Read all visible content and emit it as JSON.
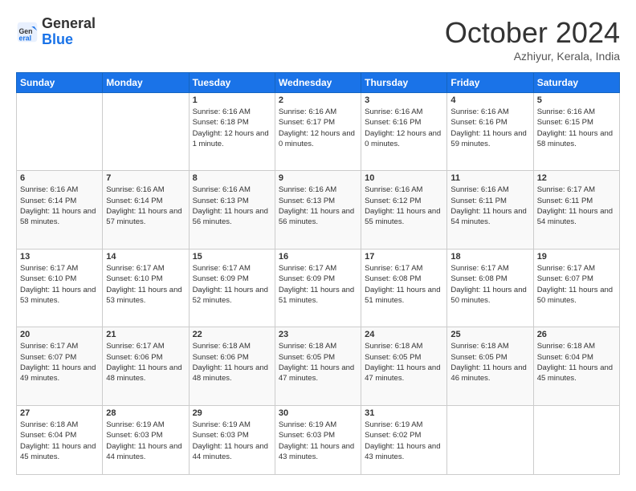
{
  "logo": {
    "line1": "General",
    "line2": "Blue"
  },
  "header": {
    "month": "October 2024",
    "location": "Azhiyur, Kerala, India"
  },
  "weekdays": [
    "Sunday",
    "Monday",
    "Tuesday",
    "Wednesday",
    "Thursday",
    "Friday",
    "Saturday"
  ],
  "weeks": [
    [
      {
        "day": "",
        "sunrise": "",
        "sunset": "",
        "daylight": ""
      },
      {
        "day": "",
        "sunrise": "",
        "sunset": "",
        "daylight": ""
      },
      {
        "day": "1",
        "sunrise": "Sunrise: 6:16 AM",
        "sunset": "Sunset: 6:18 PM",
        "daylight": "Daylight: 12 hours and 1 minute."
      },
      {
        "day": "2",
        "sunrise": "Sunrise: 6:16 AM",
        "sunset": "Sunset: 6:17 PM",
        "daylight": "Daylight: 12 hours and 0 minutes."
      },
      {
        "day": "3",
        "sunrise": "Sunrise: 6:16 AM",
        "sunset": "Sunset: 6:16 PM",
        "daylight": "Daylight: 12 hours and 0 minutes."
      },
      {
        "day": "4",
        "sunrise": "Sunrise: 6:16 AM",
        "sunset": "Sunset: 6:16 PM",
        "daylight": "Daylight: 11 hours and 59 minutes."
      },
      {
        "day": "5",
        "sunrise": "Sunrise: 6:16 AM",
        "sunset": "Sunset: 6:15 PM",
        "daylight": "Daylight: 11 hours and 58 minutes."
      }
    ],
    [
      {
        "day": "6",
        "sunrise": "Sunrise: 6:16 AM",
        "sunset": "Sunset: 6:14 PM",
        "daylight": "Daylight: 11 hours and 58 minutes."
      },
      {
        "day": "7",
        "sunrise": "Sunrise: 6:16 AM",
        "sunset": "Sunset: 6:14 PM",
        "daylight": "Daylight: 11 hours and 57 minutes."
      },
      {
        "day": "8",
        "sunrise": "Sunrise: 6:16 AM",
        "sunset": "Sunset: 6:13 PM",
        "daylight": "Daylight: 11 hours and 56 minutes."
      },
      {
        "day": "9",
        "sunrise": "Sunrise: 6:16 AM",
        "sunset": "Sunset: 6:13 PM",
        "daylight": "Daylight: 11 hours and 56 minutes."
      },
      {
        "day": "10",
        "sunrise": "Sunrise: 6:16 AM",
        "sunset": "Sunset: 6:12 PM",
        "daylight": "Daylight: 11 hours and 55 minutes."
      },
      {
        "day": "11",
        "sunrise": "Sunrise: 6:16 AM",
        "sunset": "Sunset: 6:11 PM",
        "daylight": "Daylight: 11 hours and 54 minutes."
      },
      {
        "day": "12",
        "sunrise": "Sunrise: 6:17 AM",
        "sunset": "Sunset: 6:11 PM",
        "daylight": "Daylight: 11 hours and 54 minutes."
      }
    ],
    [
      {
        "day": "13",
        "sunrise": "Sunrise: 6:17 AM",
        "sunset": "Sunset: 6:10 PM",
        "daylight": "Daylight: 11 hours and 53 minutes."
      },
      {
        "day": "14",
        "sunrise": "Sunrise: 6:17 AM",
        "sunset": "Sunset: 6:10 PM",
        "daylight": "Daylight: 11 hours and 53 minutes."
      },
      {
        "day": "15",
        "sunrise": "Sunrise: 6:17 AM",
        "sunset": "Sunset: 6:09 PM",
        "daylight": "Daylight: 11 hours and 52 minutes."
      },
      {
        "day": "16",
        "sunrise": "Sunrise: 6:17 AM",
        "sunset": "Sunset: 6:09 PM",
        "daylight": "Daylight: 11 hours and 51 minutes."
      },
      {
        "day": "17",
        "sunrise": "Sunrise: 6:17 AM",
        "sunset": "Sunset: 6:08 PM",
        "daylight": "Daylight: 11 hours and 51 minutes."
      },
      {
        "day": "18",
        "sunrise": "Sunrise: 6:17 AM",
        "sunset": "Sunset: 6:08 PM",
        "daylight": "Daylight: 11 hours and 50 minutes."
      },
      {
        "day": "19",
        "sunrise": "Sunrise: 6:17 AM",
        "sunset": "Sunset: 6:07 PM",
        "daylight": "Daylight: 11 hours and 50 minutes."
      }
    ],
    [
      {
        "day": "20",
        "sunrise": "Sunrise: 6:17 AM",
        "sunset": "Sunset: 6:07 PM",
        "daylight": "Daylight: 11 hours and 49 minutes."
      },
      {
        "day": "21",
        "sunrise": "Sunrise: 6:17 AM",
        "sunset": "Sunset: 6:06 PM",
        "daylight": "Daylight: 11 hours and 48 minutes."
      },
      {
        "day": "22",
        "sunrise": "Sunrise: 6:18 AM",
        "sunset": "Sunset: 6:06 PM",
        "daylight": "Daylight: 11 hours and 48 minutes."
      },
      {
        "day": "23",
        "sunrise": "Sunrise: 6:18 AM",
        "sunset": "Sunset: 6:05 PM",
        "daylight": "Daylight: 11 hours and 47 minutes."
      },
      {
        "day": "24",
        "sunrise": "Sunrise: 6:18 AM",
        "sunset": "Sunset: 6:05 PM",
        "daylight": "Daylight: 11 hours and 47 minutes."
      },
      {
        "day": "25",
        "sunrise": "Sunrise: 6:18 AM",
        "sunset": "Sunset: 6:05 PM",
        "daylight": "Daylight: 11 hours and 46 minutes."
      },
      {
        "day": "26",
        "sunrise": "Sunrise: 6:18 AM",
        "sunset": "Sunset: 6:04 PM",
        "daylight": "Daylight: 11 hours and 45 minutes."
      }
    ],
    [
      {
        "day": "27",
        "sunrise": "Sunrise: 6:18 AM",
        "sunset": "Sunset: 6:04 PM",
        "daylight": "Daylight: 11 hours and 45 minutes."
      },
      {
        "day": "28",
        "sunrise": "Sunrise: 6:19 AM",
        "sunset": "Sunset: 6:03 PM",
        "daylight": "Daylight: 11 hours and 44 minutes."
      },
      {
        "day": "29",
        "sunrise": "Sunrise: 6:19 AM",
        "sunset": "Sunset: 6:03 PM",
        "daylight": "Daylight: 11 hours and 44 minutes."
      },
      {
        "day": "30",
        "sunrise": "Sunrise: 6:19 AM",
        "sunset": "Sunset: 6:03 PM",
        "daylight": "Daylight: 11 hours and 43 minutes."
      },
      {
        "day": "31",
        "sunrise": "Sunrise: 6:19 AM",
        "sunset": "Sunset: 6:02 PM",
        "daylight": "Daylight: 11 hours and 43 minutes."
      },
      {
        "day": "",
        "sunrise": "",
        "sunset": "",
        "daylight": ""
      },
      {
        "day": "",
        "sunrise": "",
        "sunset": "",
        "daylight": ""
      }
    ]
  ]
}
